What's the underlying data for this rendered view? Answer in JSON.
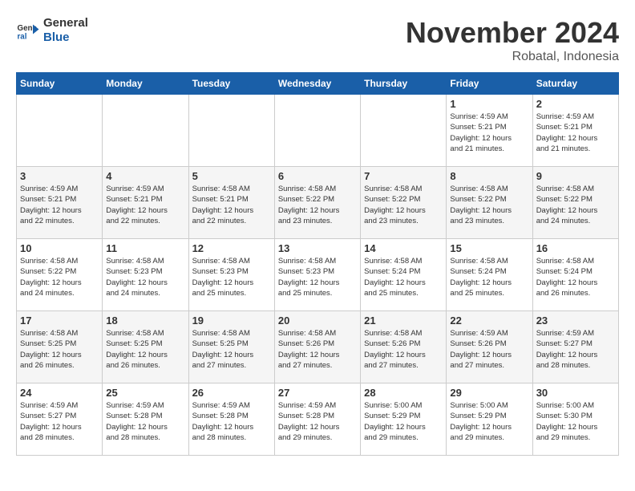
{
  "logo": {
    "line1": "General",
    "line2": "Blue"
  },
  "title": "November 2024",
  "location": "Robatal, Indonesia",
  "weekdays": [
    "Sunday",
    "Monday",
    "Tuesday",
    "Wednesday",
    "Thursday",
    "Friday",
    "Saturday"
  ],
  "weeks": [
    [
      {
        "day": "",
        "info": ""
      },
      {
        "day": "",
        "info": ""
      },
      {
        "day": "",
        "info": ""
      },
      {
        "day": "",
        "info": ""
      },
      {
        "day": "",
        "info": ""
      },
      {
        "day": "1",
        "info": "Sunrise: 4:59 AM\nSunset: 5:21 PM\nDaylight: 12 hours\nand 21 minutes."
      },
      {
        "day": "2",
        "info": "Sunrise: 4:59 AM\nSunset: 5:21 PM\nDaylight: 12 hours\nand 21 minutes."
      }
    ],
    [
      {
        "day": "3",
        "info": "Sunrise: 4:59 AM\nSunset: 5:21 PM\nDaylight: 12 hours\nand 22 minutes."
      },
      {
        "day": "4",
        "info": "Sunrise: 4:59 AM\nSunset: 5:21 PM\nDaylight: 12 hours\nand 22 minutes."
      },
      {
        "day": "5",
        "info": "Sunrise: 4:58 AM\nSunset: 5:21 PM\nDaylight: 12 hours\nand 22 minutes."
      },
      {
        "day": "6",
        "info": "Sunrise: 4:58 AM\nSunset: 5:22 PM\nDaylight: 12 hours\nand 23 minutes."
      },
      {
        "day": "7",
        "info": "Sunrise: 4:58 AM\nSunset: 5:22 PM\nDaylight: 12 hours\nand 23 minutes."
      },
      {
        "day": "8",
        "info": "Sunrise: 4:58 AM\nSunset: 5:22 PM\nDaylight: 12 hours\nand 23 minutes."
      },
      {
        "day": "9",
        "info": "Sunrise: 4:58 AM\nSunset: 5:22 PM\nDaylight: 12 hours\nand 24 minutes."
      }
    ],
    [
      {
        "day": "10",
        "info": "Sunrise: 4:58 AM\nSunset: 5:22 PM\nDaylight: 12 hours\nand 24 minutes."
      },
      {
        "day": "11",
        "info": "Sunrise: 4:58 AM\nSunset: 5:23 PM\nDaylight: 12 hours\nand 24 minutes."
      },
      {
        "day": "12",
        "info": "Sunrise: 4:58 AM\nSunset: 5:23 PM\nDaylight: 12 hours\nand 25 minutes."
      },
      {
        "day": "13",
        "info": "Sunrise: 4:58 AM\nSunset: 5:23 PM\nDaylight: 12 hours\nand 25 minutes."
      },
      {
        "day": "14",
        "info": "Sunrise: 4:58 AM\nSunset: 5:24 PM\nDaylight: 12 hours\nand 25 minutes."
      },
      {
        "day": "15",
        "info": "Sunrise: 4:58 AM\nSunset: 5:24 PM\nDaylight: 12 hours\nand 25 minutes."
      },
      {
        "day": "16",
        "info": "Sunrise: 4:58 AM\nSunset: 5:24 PM\nDaylight: 12 hours\nand 26 minutes."
      }
    ],
    [
      {
        "day": "17",
        "info": "Sunrise: 4:58 AM\nSunset: 5:25 PM\nDaylight: 12 hours\nand 26 minutes."
      },
      {
        "day": "18",
        "info": "Sunrise: 4:58 AM\nSunset: 5:25 PM\nDaylight: 12 hours\nand 26 minutes."
      },
      {
        "day": "19",
        "info": "Sunrise: 4:58 AM\nSunset: 5:25 PM\nDaylight: 12 hours\nand 27 minutes."
      },
      {
        "day": "20",
        "info": "Sunrise: 4:58 AM\nSunset: 5:26 PM\nDaylight: 12 hours\nand 27 minutes."
      },
      {
        "day": "21",
        "info": "Sunrise: 4:58 AM\nSunset: 5:26 PM\nDaylight: 12 hours\nand 27 minutes."
      },
      {
        "day": "22",
        "info": "Sunrise: 4:59 AM\nSunset: 5:26 PM\nDaylight: 12 hours\nand 27 minutes."
      },
      {
        "day": "23",
        "info": "Sunrise: 4:59 AM\nSunset: 5:27 PM\nDaylight: 12 hours\nand 28 minutes."
      }
    ],
    [
      {
        "day": "24",
        "info": "Sunrise: 4:59 AM\nSunset: 5:27 PM\nDaylight: 12 hours\nand 28 minutes."
      },
      {
        "day": "25",
        "info": "Sunrise: 4:59 AM\nSunset: 5:28 PM\nDaylight: 12 hours\nand 28 minutes."
      },
      {
        "day": "26",
        "info": "Sunrise: 4:59 AM\nSunset: 5:28 PM\nDaylight: 12 hours\nand 28 minutes."
      },
      {
        "day": "27",
        "info": "Sunrise: 4:59 AM\nSunset: 5:28 PM\nDaylight: 12 hours\nand 29 minutes."
      },
      {
        "day": "28",
        "info": "Sunrise: 5:00 AM\nSunset: 5:29 PM\nDaylight: 12 hours\nand 29 minutes."
      },
      {
        "day": "29",
        "info": "Sunrise: 5:00 AM\nSunset: 5:29 PM\nDaylight: 12 hours\nand 29 minutes."
      },
      {
        "day": "30",
        "info": "Sunrise: 5:00 AM\nSunset: 5:30 PM\nDaylight: 12 hours\nand 29 minutes."
      }
    ]
  ]
}
